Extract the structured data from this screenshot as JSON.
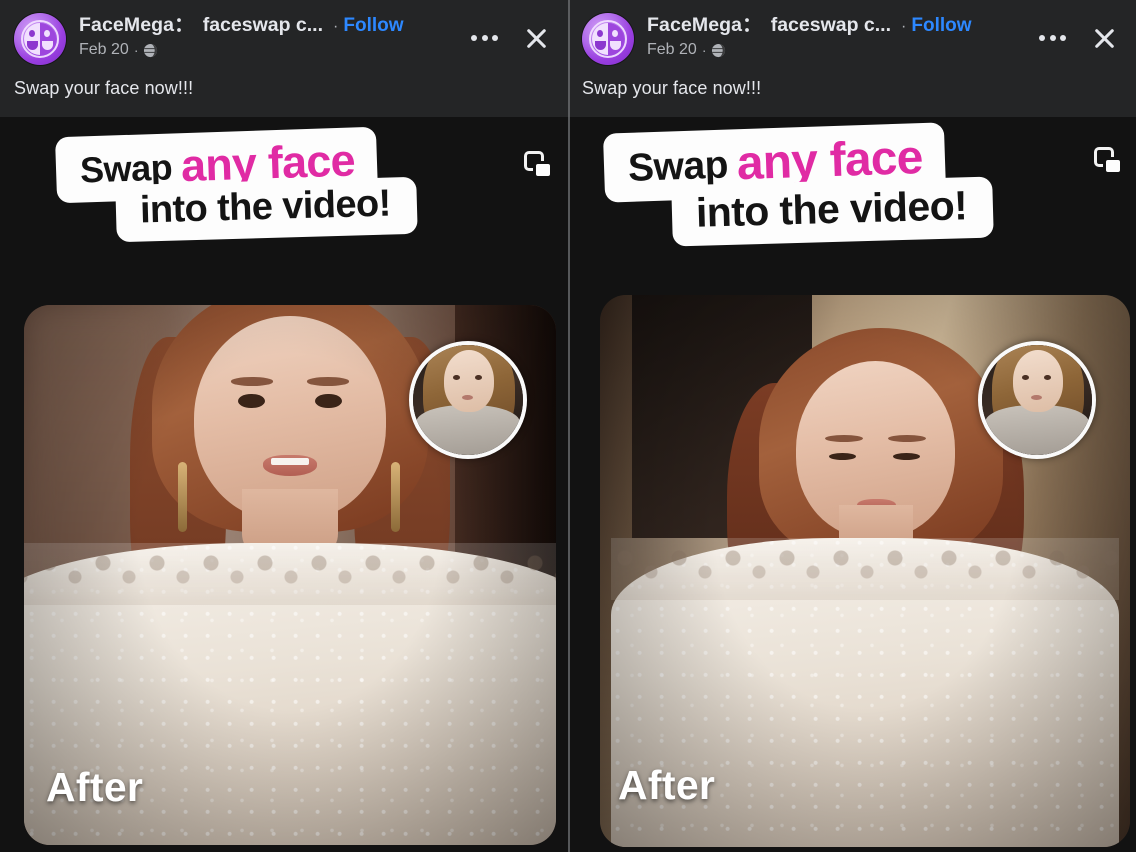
{
  "meta": {
    "accent_follow": "#2d88ff",
    "accent_promo_pink": "#e02ba4",
    "bg_header": "#242526",
    "bg_media": "#121212",
    "text_primary": "#e4e6eb",
    "text_secondary": "#b0b3b8"
  },
  "panels": [
    {
      "id": "left",
      "header": {
        "page_name": "FaceMega：",
        "page_subtitle": "faceswap c...",
        "separator": "·",
        "follow_label": "Follow",
        "date": "Feb 20",
        "meta_dot": "·",
        "privacy_icon": "globe-icon",
        "more_icon": "kebab-menu-icon",
        "close_icon": "close-icon",
        "avatar_icon": "facemega-avatar-logo"
      },
      "caption": "Swap your face now!!!",
      "promo": {
        "word1": "Swap",
        "word2": "any face",
        "word3": "into the video!",
        "copy_icon": "multiple-photos-icon"
      },
      "video": {
        "overlay_label": "After",
        "inset_icon": "source-face-thumbnail"
      }
    },
    {
      "id": "right",
      "header": {
        "page_name": "FaceMega：",
        "page_subtitle": "faceswap c...",
        "separator": "·",
        "follow_label": "Follow",
        "date": "Feb 20",
        "meta_dot": "·",
        "privacy_icon": "globe-icon",
        "more_icon": "kebab-menu-icon",
        "close_icon": "close-icon",
        "avatar_icon": "facemega-avatar-logo"
      },
      "caption": "Swap your face now!!!",
      "promo": {
        "word1": "Swap",
        "word2": "any face",
        "word3": "into the video!",
        "copy_icon": "multiple-photos-icon"
      },
      "video": {
        "overlay_label": "After",
        "inset_icon": "source-face-thumbnail"
      }
    }
  ]
}
